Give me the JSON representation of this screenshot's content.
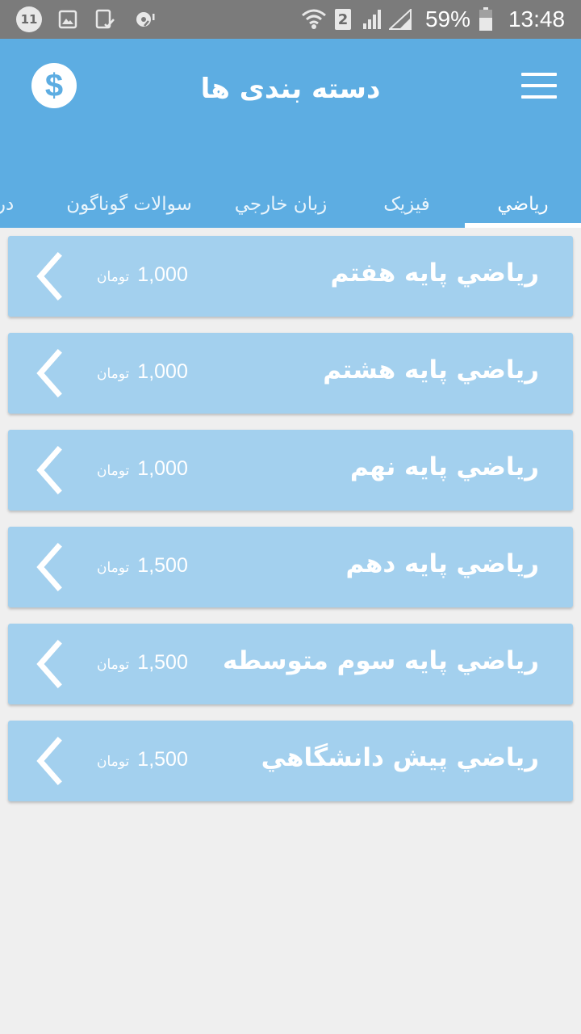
{
  "status_bar": {
    "notification_count": "11",
    "sim_slot": "2",
    "battery_percent": "59%",
    "time": "13:48",
    "icons": [
      "notification-count-icon",
      "gallery-icon",
      "device-icon",
      "cast-icon",
      "wifi-icon",
      "sim-icon",
      "signal-icon",
      "battery-icon"
    ]
  },
  "app_bar": {
    "title": "دسته بندی ها",
    "menu_icon": "hamburger-menu-icon",
    "wallet_icon": "dollar-coin-icon",
    "wallet_symbol": "$"
  },
  "tabs": [
    {
      "label": "رياضي",
      "selected": true
    },
    {
      "label": "فيزيک",
      "selected": false
    },
    {
      "label": "زبان خارجي",
      "selected": false
    },
    {
      "label": "سوالات گوناگون",
      "selected": false
    },
    {
      "label": "درو",
      "selected": false
    }
  ],
  "items": [
    {
      "title": "رياضي پايه هفتم",
      "price": "1,000",
      "unit": "تومان"
    },
    {
      "title": "رياضي پايه هشتم",
      "price": "1,000",
      "unit": "تومان"
    },
    {
      "title": "رياضي پايه نهم",
      "price": "1,000",
      "unit": "تومان"
    },
    {
      "title": "رياضي پايه دهم",
      "price": "1,500",
      "unit": "تومان"
    },
    {
      "title": "رياضي پايه سوم متوسطه",
      "price": "1,500",
      "unit": "تومان"
    },
    {
      "title": "رياضي پيش دانشگاهي",
      "price": "1,500",
      "unit": "تومان"
    }
  ],
  "colors": {
    "primary": "#5dade2",
    "card": "#a3d0ee",
    "background": "#efefef",
    "status_bar": "#7b7b7b"
  }
}
